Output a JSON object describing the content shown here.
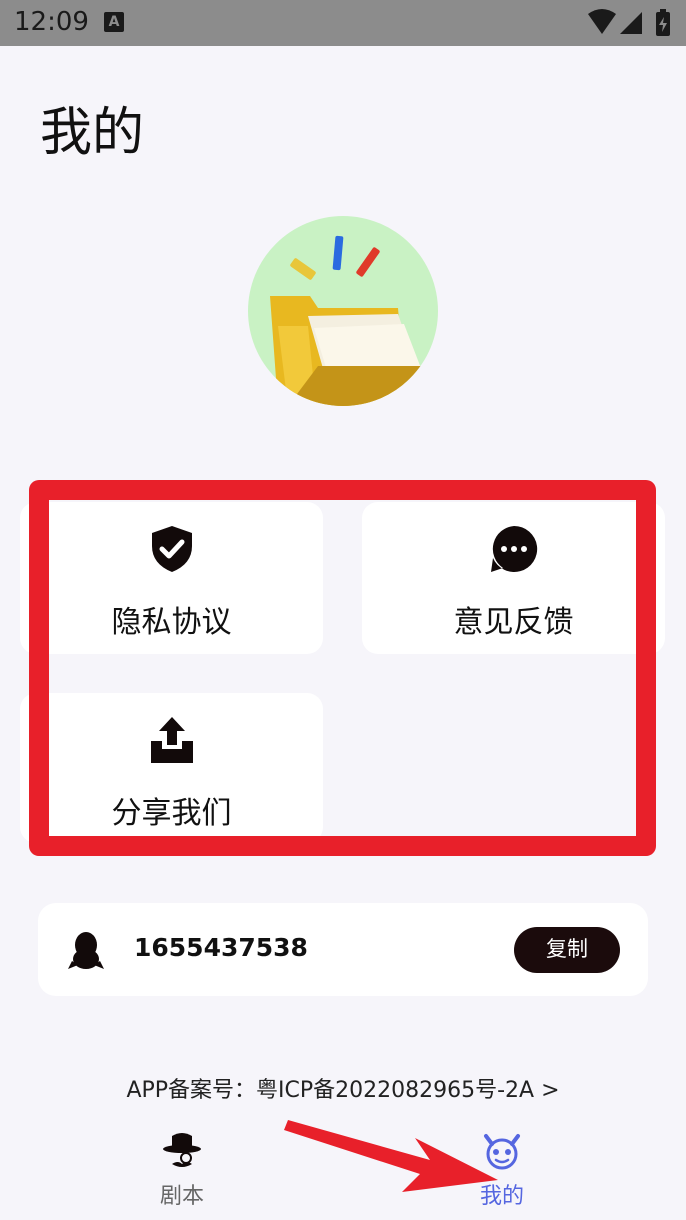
{
  "status_bar": {
    "time": "12:09",
    "notification_glyph": "A"
  },
  "page": {
    "title": "我的"
  },
  "menu": {
    "privacy_label": "隐私协议",
    "feedback_label": "意见反馈",
    "share_label": "分享我们"
  },
  "qq": {
    "number": "1655437538",
    "copy_label": "复制"
  },
  "footer": {
    "beian": "APP备案号：粤ICP备2022082965号-2A >"
  },
  "tabs": [
    {
      "label": "剧本",
      "icon": "detective-hat-icon",
      "active": false
    },
    {
      "label": "我的",
      "icon": "devil-face-icon",
      "active": true
    }
  ],
  "colors": {
    "accent": "#5566e0",
    "highlight": "#e8202a",
    "copy_button": "#1b0b0c",
    "hero_bg": "#c9f2c4"
  }
}
